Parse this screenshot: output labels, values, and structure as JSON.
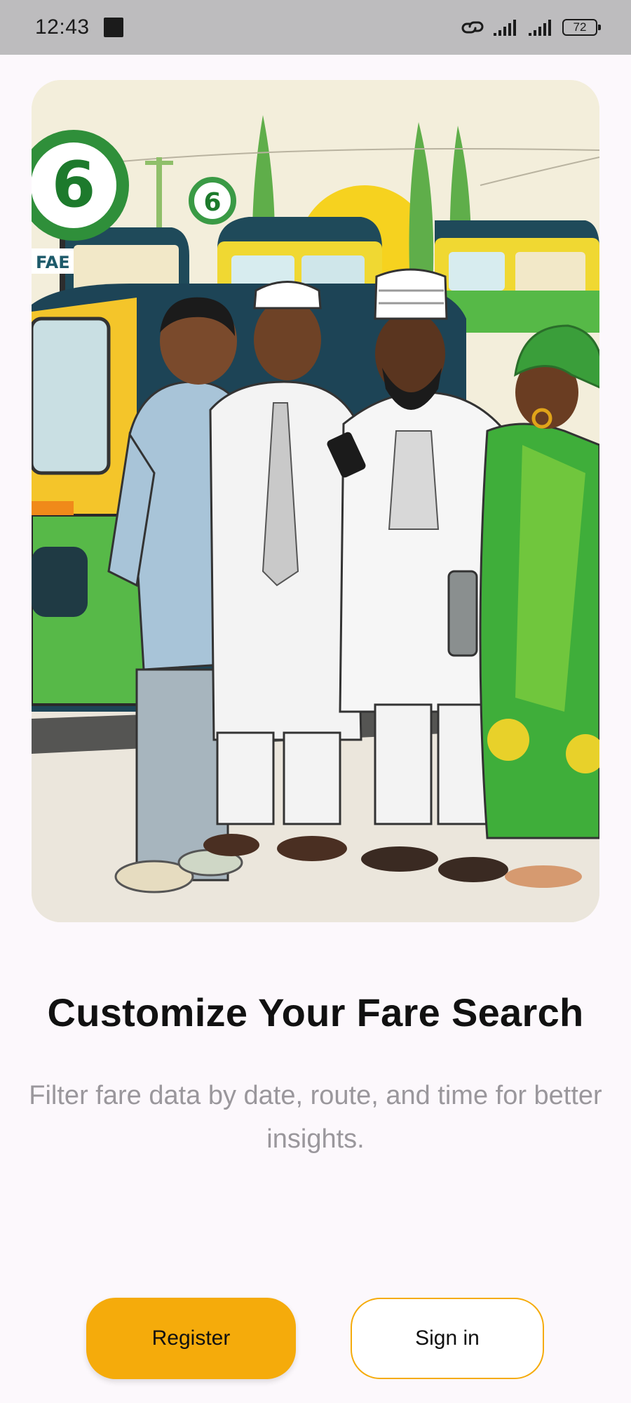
{
  "status_bar": {
    "time": "12:43",
    "battery_level": "72",
    "icons": [
      "link-icon",
      "signal-icon",
      "signal-icon",
      "battery-icon"
    ]
  },
  "hero": {
    "sign_number": "6",
    "sign_text": "FAE"
  },
  "content": {
    "title": "Customize Your Fare Search",
    "subtitle": "Filter fare data by date, route, and time for better insights."
  },
  "actions": {
    "register_label": "Register",
    "signin_label": "Sign in"
  },
  "colors": {
    "accent": "#F5AB0B",
    "background": "#FCF8FC",
    "status_bar": "#BDBCBE"
  }
}
